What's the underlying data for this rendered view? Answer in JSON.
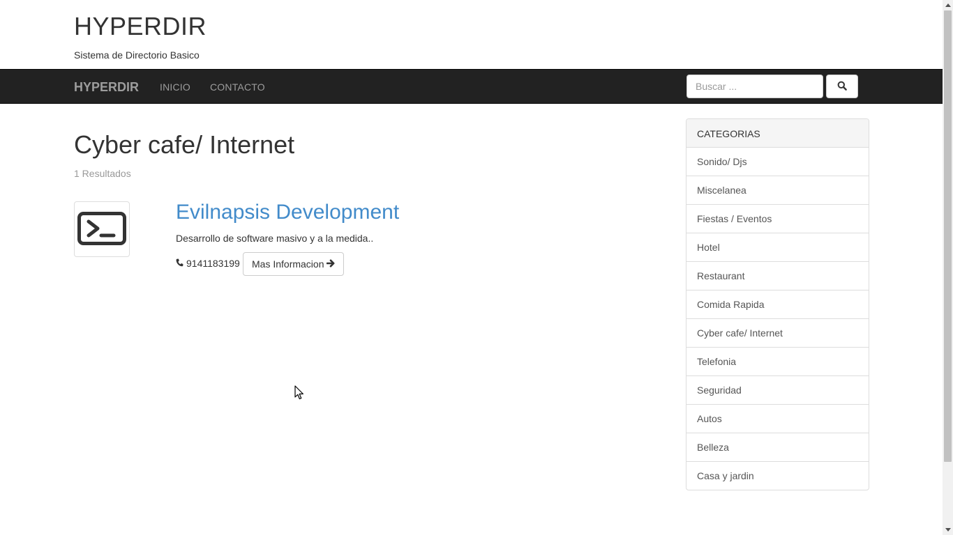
{
  "header": {
    "site_title": "HYPERDIR",
    "site_subtitle": "Sistema de Directorio Basico"
  },
  "navbar": {
    "brand": "HYPERDIR",
    "links": [
      "INICIO",
      "CONTACTO"
    ],
    "search_placeholder": "Buscar ...",
    "search_icon": "search-icon"
  },
  "main": {
    "category_title": "Cyber cafe/ Internet",
    "results_count": "1 Resultados",
    "listing": {
      "thumbnail_icon": "terminal-icon",
      "title": "Evilnapsis Development",
      "description": "Desarrollo de software masivo y a la medida..",
      "phone_icon": "phone-icon",
      "phone": "9141183199",
      "more_button": "Mas Informacion",
      "more_icon": "arrow-right-icon"
    }
  },
  "sidebar": {
    "heading": "CATEGORIAS",
    "items": [
      "Sonido/ Djs",
      "Miscelanea",
      "Fiestas / Eventos",
      "Hotel",
      "Restaurant",
      "Comida Rapida",
      "Cyber cafe/ Internet",
      "Telefonia",
      "Seguridad",
      "Autos",
      "Belleza",
      "Casa y jardin"
    ]
  },
  "colors": {
    "navbar_bg": "#222222",
    "navbar_text": "#9d9d9d",
    "link": "#428bca",
    "muted": "#999999",
    "panel_heading_bg": "#f5f5f5",
    "border": "#dddddd"
  }
}
